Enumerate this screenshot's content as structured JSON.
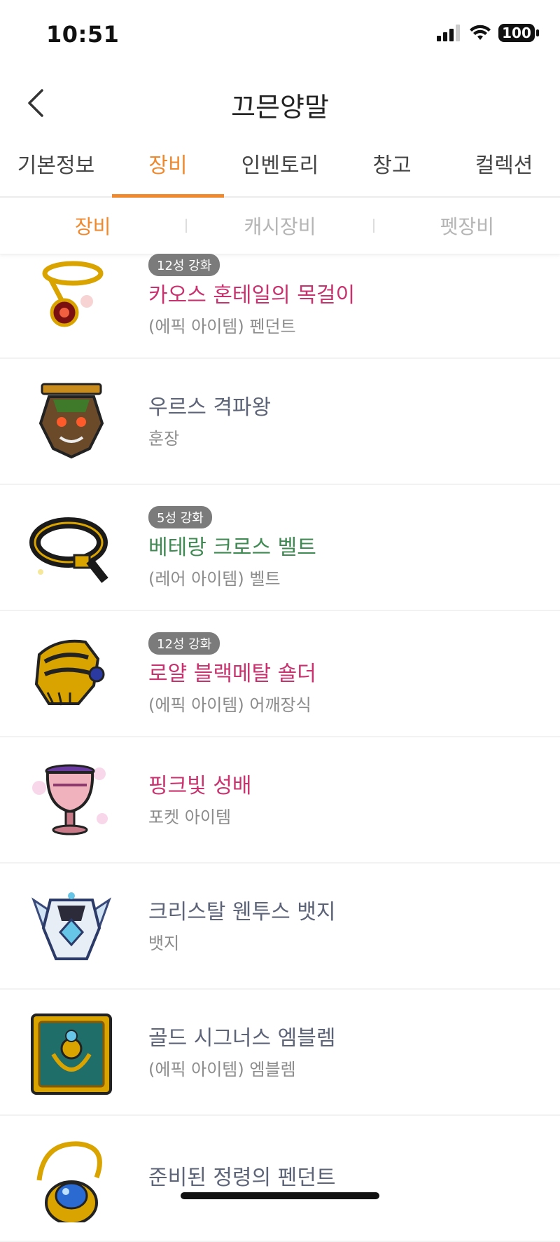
{
  "status": {
    "time": "10:51",
    "battery": "100"
  },
  "header": {
    "title": "끄믄양말"
  },
  "tabs": [
    "기본정보",
    "장비",
    "인벤토리",
    "창고",
    "컬렉션"
  ],
  "sub_tabs": [
    "장비",
    "캐시장비",
    "펫장비"
  ],
  "items": [
    {
      "badge": "12성 강화",
      "name": "카오스 혼테일의 목걸이",
      "grade": "(에픽 아이템) 펜던트",
      "rarity": "epic"
    },
    {
      "badge": "",
      "name": "우르스 격파왕",
      "grade": "훈장",
      "rarity": "normal"
    },
    {
      "badge": "5성 강화",
      "name": "베테랑 크로스 벨트",
      "grade": "(레어 아이템) 벨트",
      "rarity": "rare"
    },
    {
      "badge": "12성 강화",
      "name": "로얄 블랙메탈 숄더",
      "grade": "(에픽 아이템) 어깨장식",
      "rarity": "epic"
    },
    {
      "badge": "",
      "name": "핑크빛 성배",
      "grade": "포켓 아이템",
      "rarity": "epic"
    },
    {
      "badge": "",
      "name": "크리스탈 웬투스 뱃지",
      "grade": "뱃지",
      "rarity": "normal"
    },
    {
      "badge": "",
      "name": "골드 시그너스 엠블렘",
      "grade": "(에픽 아이템) 엠블렘",
      "rarity": "normal"
    },
    {
      "badge": "",
      "name": "준비된 정령의 펜던트",
      "grade": "",
      "rarity": "normal"
    }
  ],
  "colors": {
    "accent": "#f0892e",
    "epic": "#c8326e",
    "rare": "#3f8a52",
    "normal": "#5d6478"
  }
}
